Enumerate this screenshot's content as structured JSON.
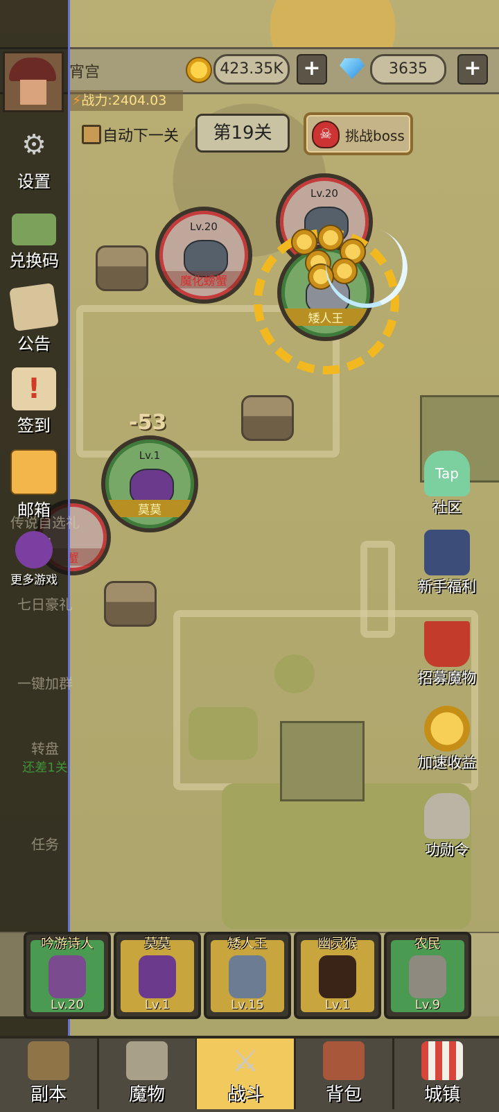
{
  "header": {
    "player_name": "宵宫",
    "gold": "423.35K",
    "gems": "3635",
    "power": "战力:2404.03",
    "plus_symbol": "+"
  },
  "controls": {
    "auto_next": "自动下一关",
    "stage": "第19关",
    "boss_button": "挑战boss"
  },
  "battle": {
    "enemy1": {
      "level": "Lv.20",
      "name": "魔化螃蟹"
    },
    "enemy2": {
      "level": "Lv.20"
    },
    "ally_leader": {
      "name": "矮人王"
    },
    "ally_unit": {
      "level": "Lv.1",
      "name": "莫莫"
    },
    "damage": "-53",
    "partial_enemy_name": "蟹"
  },
  "left_menu": [
    {
      "label": "设置",
      "icon": "gear-icon"
    },
    {
      "label": "兑换码",
      "icon": "ticket-icon"
    },
    {
      "label": "公告",
      "icon": "notice-icon"
    },
    {
      "label": "签到",
      "icon": "scroll-icon"
    },
    {
      "label": "邮箱",
      "icon": "mail-icon"
    },
    {
      "label": "更多游戏",
      "icon": "more-games-icon"
    }
  ],
  "left_hidden": {
    "legend_pack": "传说自选礼包",
    "seven_day": "七日豪礼",
    "join_group": "一键加群",
    "wheel": "转盘",
    "wheel_sub": "还差1关",
    "task": "任务"
  },
  "right_menu": [
    {
      "label": "社区",
      "icon": "tap-community-icon",
      "icon_text": "Tap"
    },
    {
      "label": "新手福利",
      "icon": "king-icon"
    },
    {
      "label": "招募魔物",
      "icon": "banner-icon"
    },
    {
      "label": "加速收益",
      "icon": "coin-boost-icon"
    },
    {
      "label": "功勋令",
      "icon": "helmet-icon"
    }
  ],
  "roster": [
    {
      "name": "吟游诗人",
      "level": "Lv.20",
      "color": "#4b9a52"
    },
    {
      "name": "莫莫",
      "level": "Lv.1",
      "color": "#c9a53e"
    },
    {
      "name": "矮人王",
      "level": "Lv.15",
      "color": "#c9a53e"
    },
    {
      "name": "幽灵猴",
      "level": "Lv.1",
      "color": "#c9a53e"
    },
    {
      "name": "农民",
      "level": "Lv.9",
      "color": "#4b9a52"
    }
  ],
  "bottom_nav": [
    {
      "label": "副本",
      "icon": "map-icon"
    },
    {
      "label": "魔物",
      "icon": "monster-icon"
    },
    {
      "label": "战斗",
      "icon": "crossed-swords-icon",
      "active": true
    },
    {
      "label": "背包",
      "icon": "backpack-icon"
    },
    {
      "label": "城镇",
      "icon": "town-icon"
    }
  ]
}
